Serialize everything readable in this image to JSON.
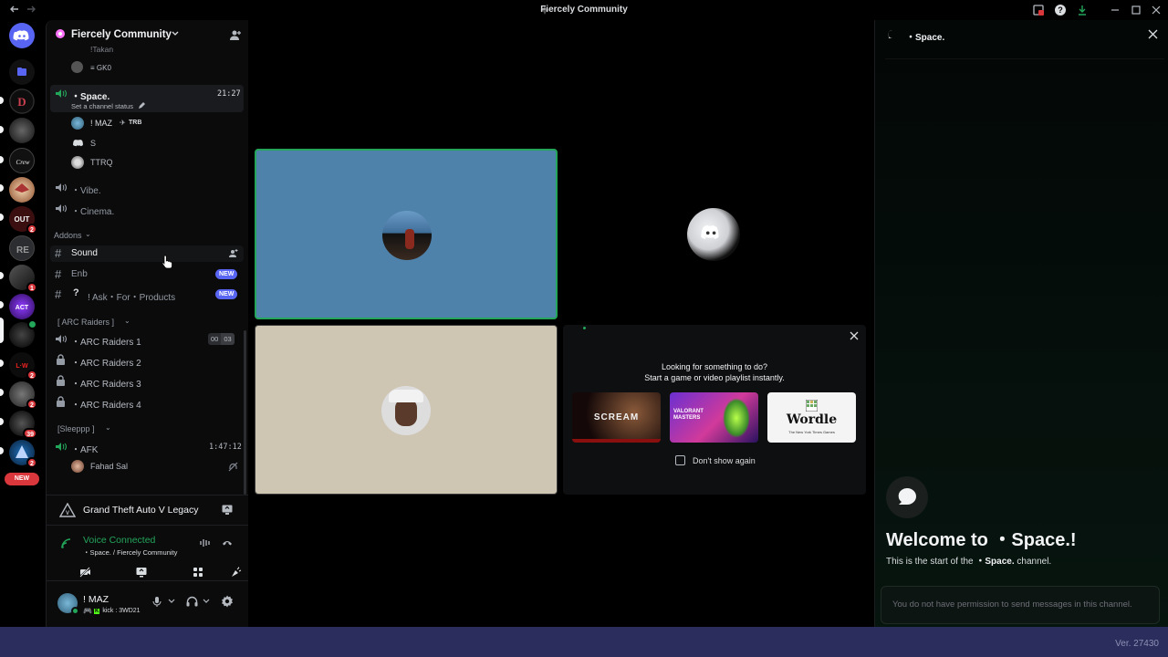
{
  "window": {
    "title": "Fiercely Community"
  },
  "server": {
    "name": "Fiercely Community"
  },
  "channels": {
    "top_users": [
      {
        "name": "!Takan"
      },
      {
        "name": "≡ GK0"
      }
    ],
    "space": {
      "name": "・Space.",
      "timer": "21:27",
      "status": "Set a channel status",
      "users": [
        {
          "name": "! MAZ",
          "tag": "TRB"
        },
        {
          "name": "S"
        },
        {
          "name": "TTRQ"
        }
      ]
    },
    "vibe": "・Vibe.",
    "cinema": "・Cinema.",
    "addons_category": "Addons",
    "sound": "Sound",
    "enb": "Enb",
    "ask": "! Ask・For・Products",
    "new_badge": "NEW",
    "arc_category": "[ ARC Raiders ]",
    "arc": [
      "・ARC Raiders 1",
      "・ARC Raiders 2",
      "・ARC Raiders 3",
      "・ARC Raiders 4"
    ],
    "arc1_counts": [
      "00",
      "03"
    ],
    "sleep_category": "[Sleeppp ]",
    "afk": {
      "name": "・AFK",
      "timer": "1:47:12",
      "user": "Fahad Sal"
    }
  },
  "game_activity": {
    "name": "Grand Theft Auto V Legacy"
  },
  "voice": {
    "status": "Voice Connected",
    "location": "・Space. / Fiercely Community"
  },
  "user": {
    "name": "! MAZ",
    "status": "kick : 3WD21"
  },
  "rail": {
    "new_badge": "NEW",
    "badges": [
      "2",
      "1",
      "2",
      "2",
      "39",
      "2"
    ]
  },
  "activity_prompt": {
    "line1": "Looking for something to do?",
    "line2": "Start a game or video playlist instantly.",
    "games": [
      "SCREAM",
      "VALORANT MASTERS",
      "Wordle"
    ],
    "wordle_sub": "The New York Times Games",
    "dont_show": "Don't show again"
  },
  "right_panel": {
    "title": "・Space.",
    "welcome": "Welcome to ・Space.!",
    "start_prefix": "This is the start of the ",
    "start_channel": "・Space.",
    "start_suffix": " channel.",
    "no_permission": "You do not have permission to send messages in this channel."
  },
  "footer": {
    "version": "Ver. 27430"
  },
  "colors": {
    "accent": "#5865f2",
    "green": "#23a55a",
    "danger": "#da373c",
    "tile_blue": "#4f82ab",
    "tile_beige": "#cfc5b3"
  }
}
